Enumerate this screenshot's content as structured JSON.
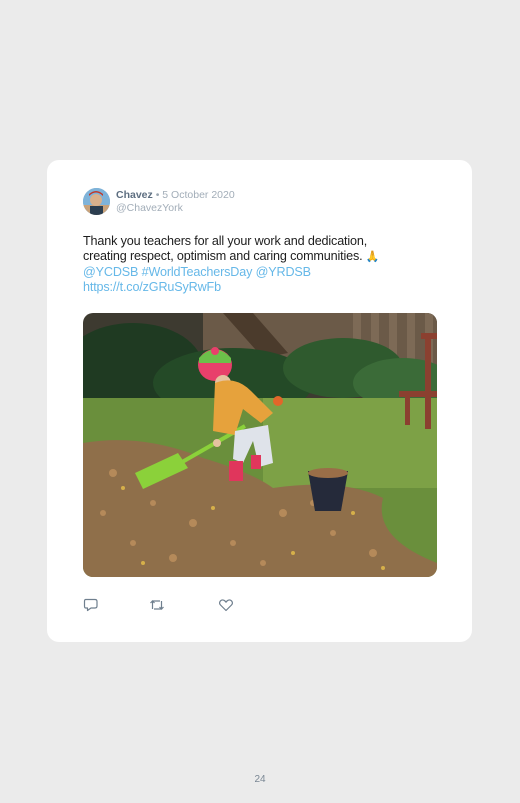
{
  "tweet": {
    "author_name": "Chavez",
    "separator": "•",
    "date": "5 October 2020",
    "handle": "@ChavezYork",
    "text_line1": "Thank you teachers for all your work and dedication,",
    "text_line2": "creating respect, optimism and caring communities.",
    "emoji": "🙏",
    "mention1": "@YCDSB",
    "hashtag": "#WorldTeachersDay",
    "mention2": "@YRDSB",
    "link": "https://t.co/zGRuSyRwFb"
  },
  "actions": {
    "reply_icon": "reply-icon",
    "retweet_icon": "retweet-icon",
    "like_icon": "heart-icon"
  },
  "page": {
    "number": "24"
  },
  "colors": {
    "background": "#ebebeb",
    "card": "#ffffff",
    "link": "#66b8e8",
    "name": "#5d6e80",
    "muted": "#a2adb8"
  }
}
